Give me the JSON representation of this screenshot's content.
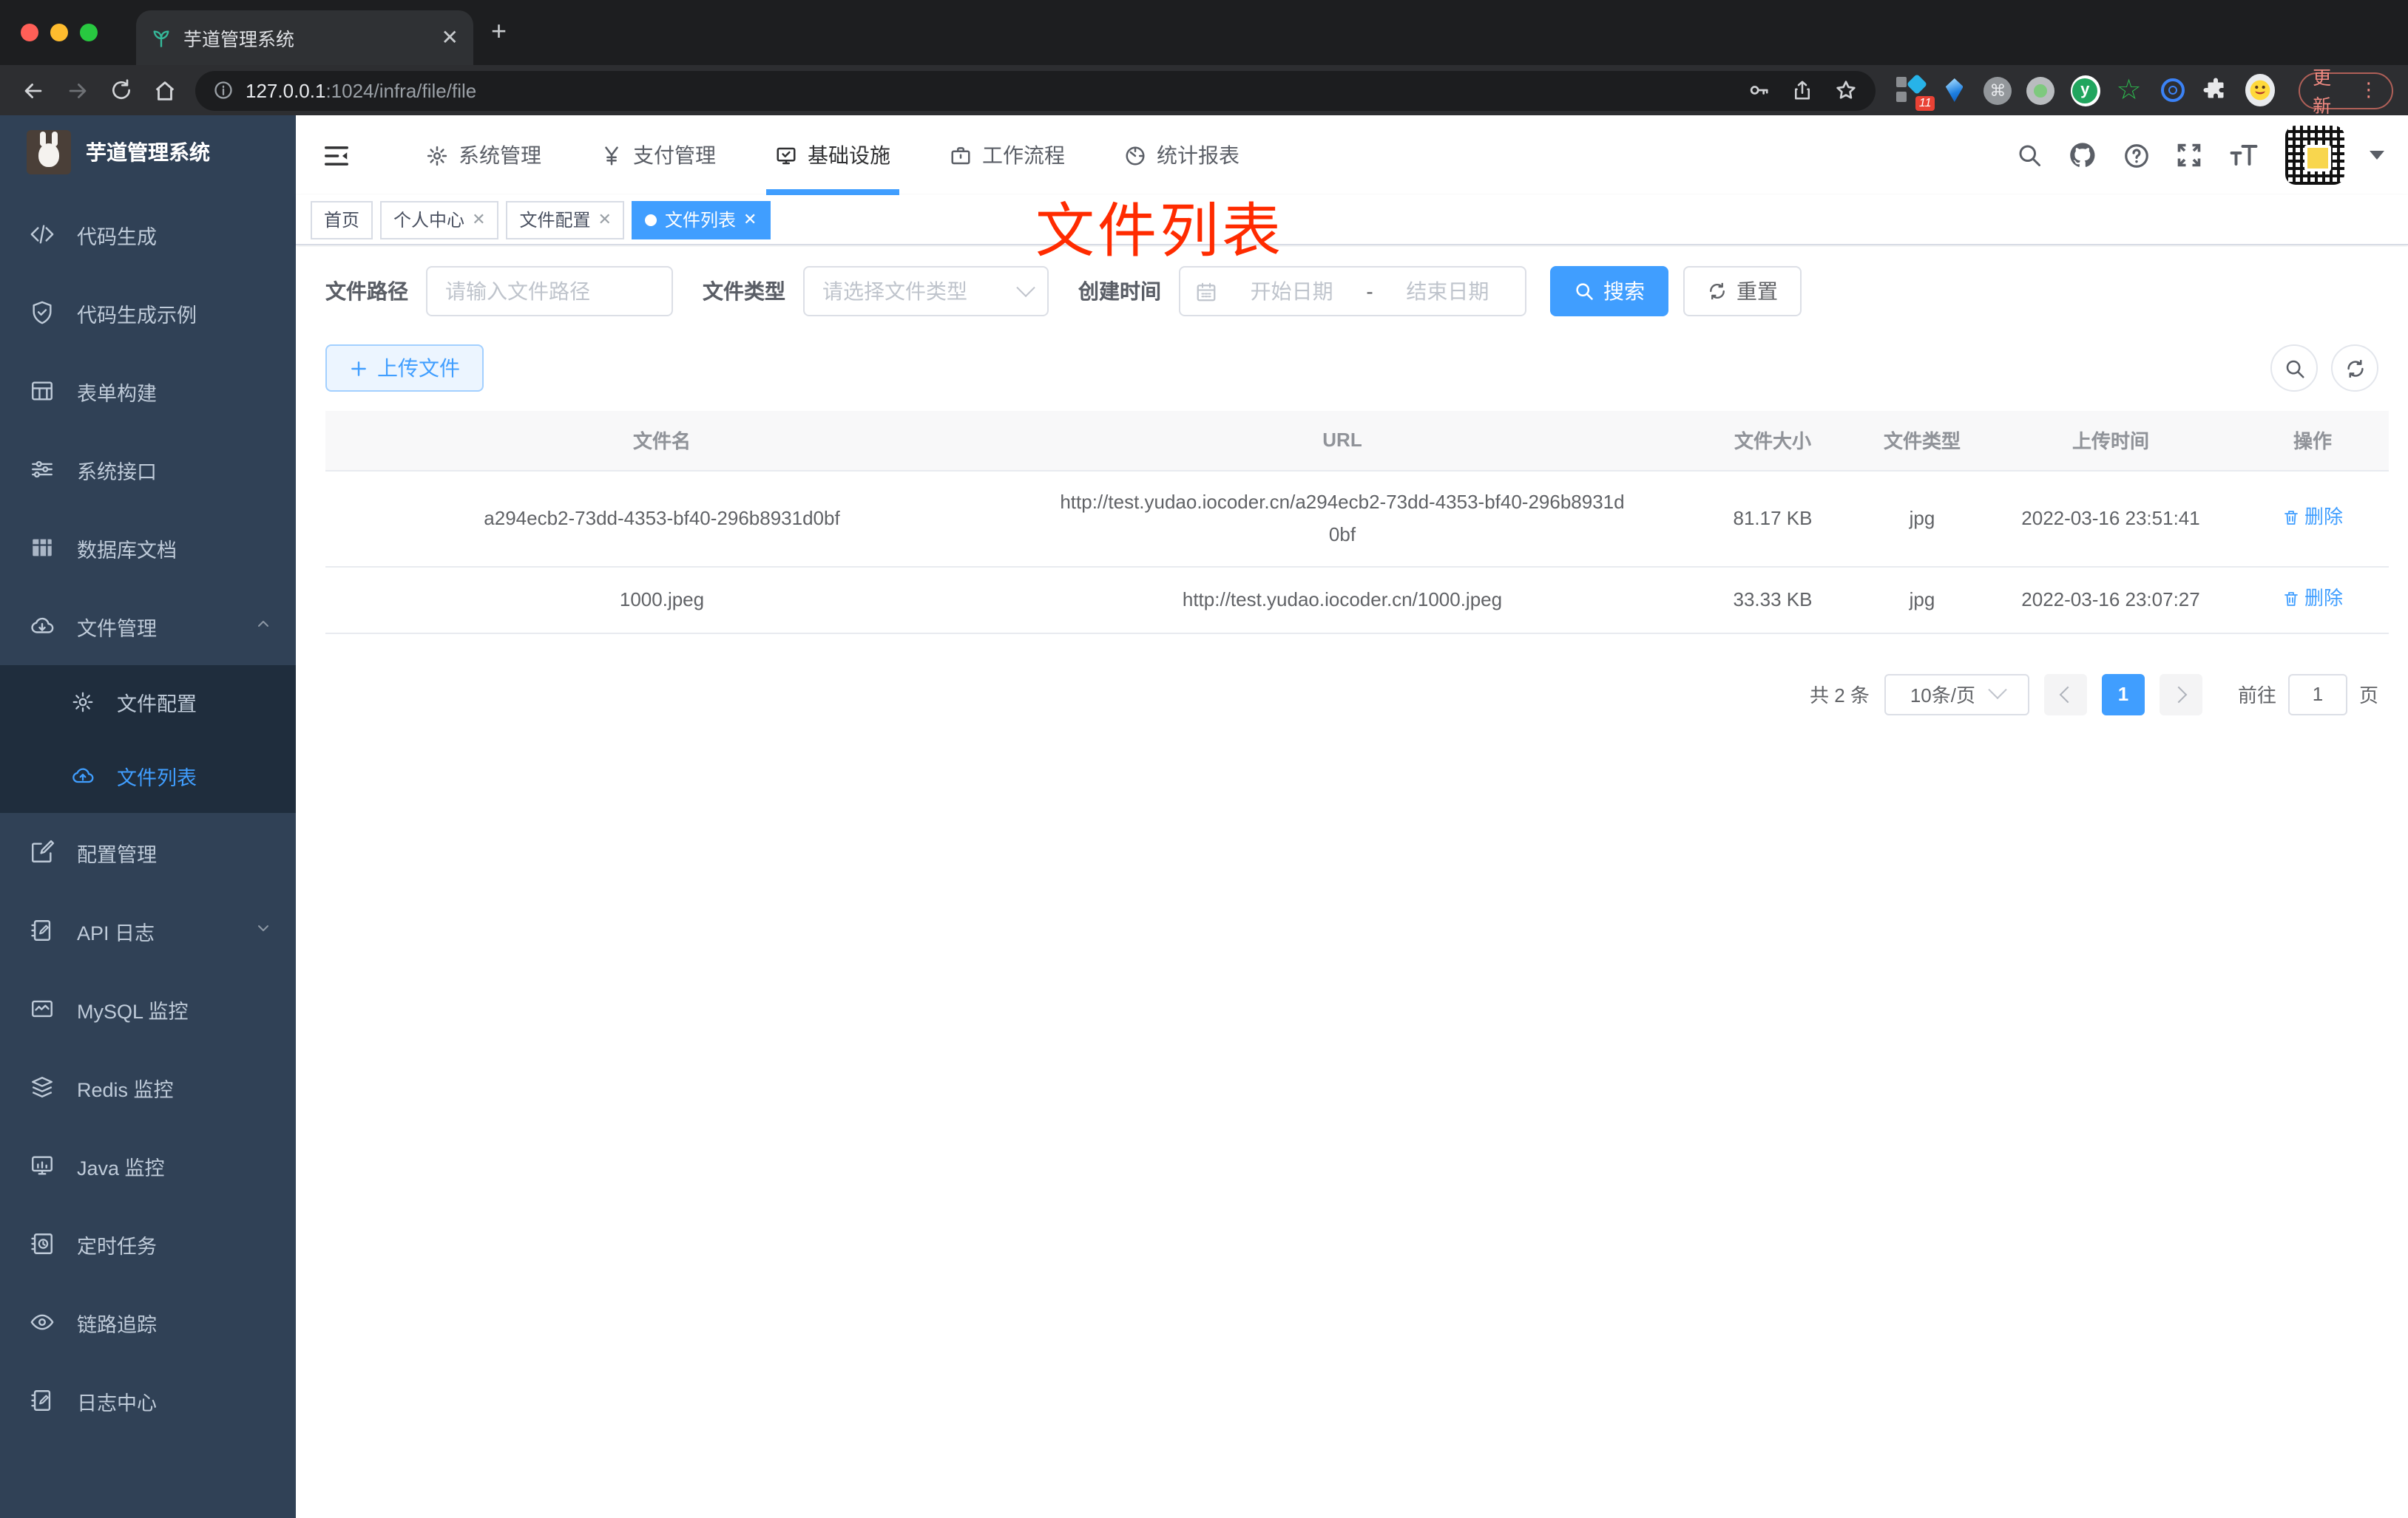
{
  "browser": {
    "tab_title": "芋道管理系统",
    "url_host": "127.0.0.1",
    "url_path": ":1024/infra/file/file",
    "new_tab": "+",
    "close_tab": "✕",
    "extension_badge": "11",
    "command_glyph": "⌘",
    "y_glyph": "y",
    "star_glyph": "☆",
    "update_label": "更新",
    "menu_dots": "⋮"
  },
  "header": {
    "top_menu": [
      {
        "label": "系统管理",
        "icon": "gear-icon"
      },
      {
        "label": "支付管理",
        "icon": "yen-icon"
      },
      {
        "label": "基础设施",
        "icon": "monitor-check-icon",
        "active": true
      },
      {
        "label": "工作流程",
        "icon": "briefcase-icon"
      },
      {
        "label": "统计报表",
        "icon": "dashboard-icon"
      }
    ]
  },
  "tags": [
    {
      "label": "首页",
      "closable": false
    },
    {
      "label": "个人中心",
      "closable": true
    },
    {
      "label": "文件配置",
      "closable": true
    },
    {
      "label": "文件列表",
      "closable": true,
      "active": true
    }
  ],
  "watermark": "文件列表",
  "sidebar": {
    "logo_title": "芋道管理系统",
    "items": [
      {
        "label": "代码生成",
        "icon": "code-icon"
      },
      {
        "label": "代码生成示例",
        "icon": "shield-check-icon"
      },
      {
        "label": "表单构建",
        "icon": "table-icon"
      },
      {
        "label": "系统接口",
        "icon": "sliders-icon"
      },
      {
        "label": "数据库文档",
        "icon": "grid-icon"
      },
      {
        "label": "文件管理",
        "icon": "cloud-download-icon",
        "expanded": true,
        "children": [
          {
            "label": "文件配置",
            "icon": "gear-icon"
          },
          {
            "label": "文件列表",
            "icon": "cloud-upload-icon",
            "active": true
          }
        ]
      },
      {
        "label": "配置管理",
        "icon": "edit-icon"
      },
      {
        "label": "API 日志",
        "icon": "document-edit-icon",
        "collapsed": true
      },
      {
        "label": "MySQL 监控",
        "icon": "chart-line-icon"
      },
      {
        "label": "Redis 监控",
        "icon": "layers-icon"
      },
      {
        "label": "Java 监控",
        "icon": "monitor-bars-icon"
      },
      {
        "label": "定时任务",
        "icon": "schedule-icon"
      },
      {
        "label": "链路追踪",
        "icon": "eye-icon"
      },
      {
        "label": "日志中心",
        "icon": "log-edit-icon"
      }
    ]
  },
  "filters": {
    "path_label": "文件路径",
    "path_placeholder": "请输入文件路径",
    "type_label": "文件类型",
    "type_placeholder": "请选择文件类型",
    "date_label": "创建时间",
    "date_start_placeholder": "开始日期",
    "date_separator": "-",
    "date_end_placeholder": "结束日期",
    "search_label": "搜索",
    "reset_label": "重置",
    "upload_label": "上传文件"
  },
  "table": {
    "columns": [
      "文件名",
      "URL",
      "文件大小",
      "文件类型",
      "上传时间",
      "操作"
    ],
    "rows": [
      {
        "name": "a294ecb2-73dd-4353-bf40-296b8931d0bf",
        "url": "http://test.yudao.iocoder.cn/a294ecb2-73dd-4353-bf40-296b8931d0bf",
        "size": "81.17 KB",
        "type": "jpg",
        "time": "2022-03-16 23:51:41"
      },
      {
        "name": "1000.jpeg",
        "url": "http://test.yudao.iocoder.cn/1000.jpeg",
        "size": "33.33 KB",
        "type": "jpg",
        "time": "2022-03-16 23:07:27"
      }
    ],
    "delete_label": "删除"
  },
  "pagination": {
    "total_label": "共 2 条",
    "page_size": "10条/页",
    "current_page": "1",
    "goto_label": "前往",
    "goto_value": "1",
    "page_unit": "页"
  },
  "colors": {
    "primary": "#409eff",
    "sidebar_bg": "#304156",
    "submenu_bg": "#1f2d3d",
    "annotation_red": "#ff2b00"
  }
}
